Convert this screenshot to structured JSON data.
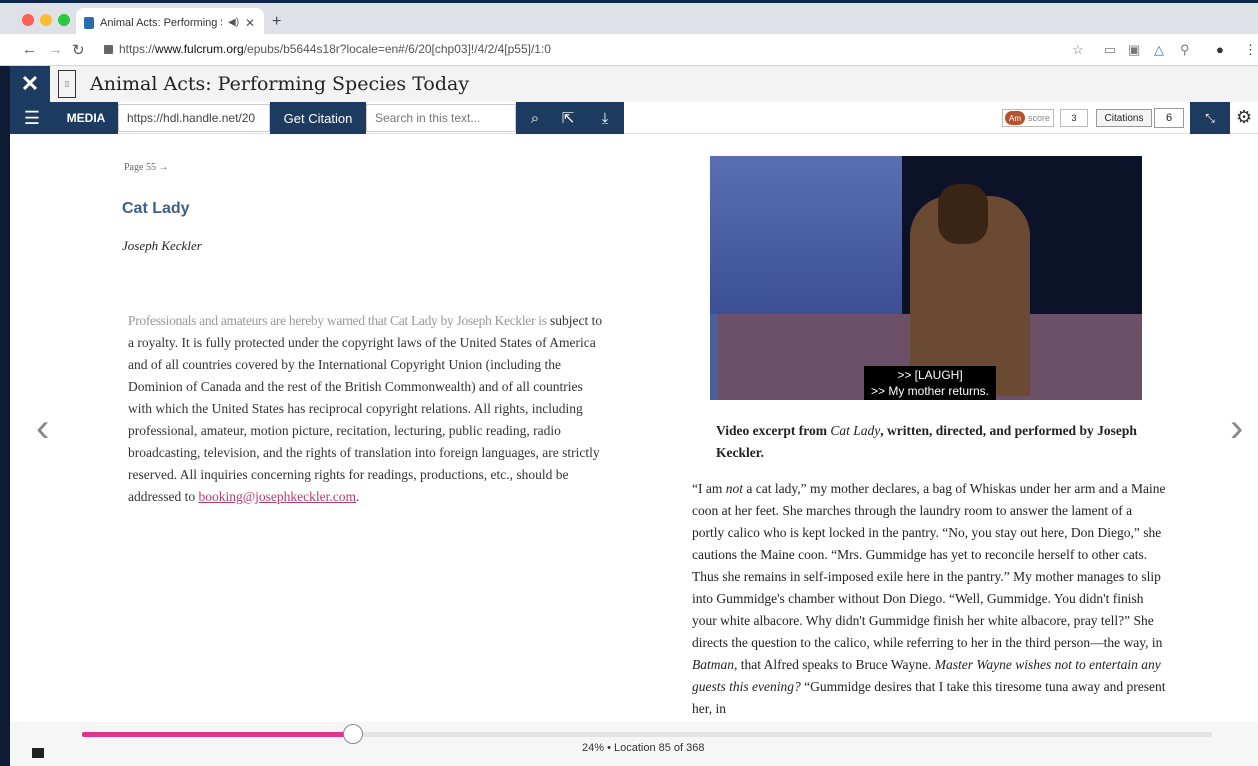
{
  "browser": {
    "tab_title": "Animal Acts: Performing Sp",
    "new_tab": "+",
    "url_prefix": "https://",
    "url_domain": "www.fulcrum.org",
    "url_path": "/epubs/b5644s18r?locale=en#/6/20[chp03]!/4/2/4[p55]/1:0"
  },
  "header": {
    "close": "✕",
    "title": "Animal Acts: Performing Species Today"
  },
  "toolbar": {
    "media_label": "MEDIA",
    "handle_value": "https://hdl.handle.net/20",
    "cite_label": "Get Citation",
    "search_placeholder": "Search in this text...",
    "altmetric_label": "score",
    "altmetric_score": "3",
    "citations_label": "Citations",
    "citations_count": "6"
  },
  "page": {
    "marker": "Page 55 →",
    "chapter_title": "Cat Lady",
    "author": "Joseph Keckler",
    "rights_first_line": "Professionals and amateurs are hereby warned that Cat Lady by Joseph Keckler is",
    "rights_body": "subject to a royalty. It is fully protected under the copyright laws of the United States of America and of all countries covered by the International Copyright Union (including the Dominion of Canada and the rest of the British Commonwealth) and of all countries with which the United States has reciprocal copyright relations. All rights, including professional, amateur, motion picture, recitation, lecturing, public reading, radio broadcasting, television, and the rights of translation into foreign languages, are strictly reserved. All inquiries concerning rights for readings, productions, etc., should be addressed to ",
    "rights_email": "booking@josephkeckler.com",
    "rights_end": "."
  },
  "video": {
    "caption_line1": ">> [LAUGH]",
    "caption_line2": ">> My mother returns.",
    "desc_before": "Video excerpt from ",
    "desc_italic": "Cat Lady",
    "desc_after": ", written, directed, and performed by Joseph Keckler."
  },
  "body": {
    "p1_a": "“I am ",
    "p1_em": "not",
    "p1_b": " a cat lady,” my mother declares, a bag of Whiskas under her arm and a Maine coon at her feet. She marches through the laundry room to answer the lament of a portly calico who is kept locked in the pantry. “No, you stay out here, Don Diego,” she cautions the Maine coon. “Mrs. Gummidge has yet to reconcile herself to other cats. Thus she remains in self-imposed exile here in the pantry.” My mother manages to slip into Gummidge's chamber without Don Diego. “Well, Gummidge. You didn't finish your white albacore. Why didn't Gummidge finish her white albacore, pray tell?” She directs the question to the calico, while referring to her in the third person—the way, in ",
    "p1_em2": "Batman",
    "p1_c": ", that Alfred speaks to Bruce Wayne. ",
    "p1_em3": "Master Wayne wishes not to entertain any guests this evening?",
    "p1_d": " “Gummidge desires that I take this tiresome tuna away and present her, in"
  },
  "progress": {
    "percent": 24,
    "label": "24% • Location 85 of 368"
  },
  "colors": {
    "navy": "#1d3b61",
    "progress_fill": "#e0368a",
    "chapter": "#3f5f86"
  }
}
